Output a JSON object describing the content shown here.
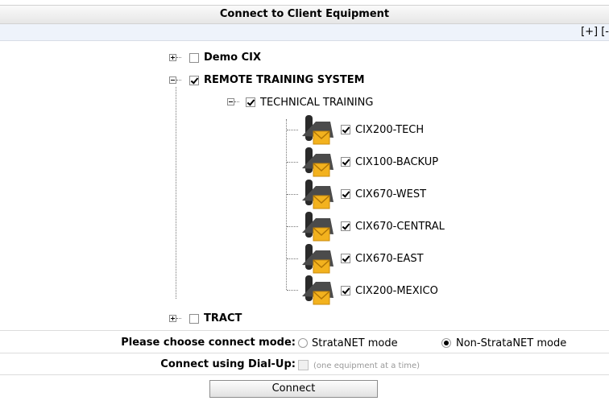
{
  "header": {
    "title": "Connect to Client Equipment"
  },
  "expand_bar": {
    "text": "[+] [-"
  },
  "tree": {
    "nodes": [
      {
        "label": "Demo CIX",
        "checked": false,
        "expanded": false
      },
      {
        "label": "REMOTE TRAINING SYSTEM",
        "checked": true,
        "expanded": true
      },
      {
        "label": "TECHNICAL TRAINING",
        "checked": true,
        "expanded": true
      },
      {
        "label": "CIX200-TECH",
        "checked": true,
        "icon": "phone-email-icon"
      },
      {
        "label": "CIX100-BACKUP",
        "checked": true,
        "icon": "phone-email-icon"
      },
      {
        "label": "CIX670-WEST",
        "checked": true,
        "icon": "phone-email-icon"
      },
      {
        "label": "CIX670-CENTRAL",
        "checked": true,
        "icon": "phone-email-icon"
      },
      {
        "label": "CIX670-EAST",
        "checked": true,
        "icon": "phone-email-icon"
      },
      {
        "label": "CIX200-MEXICO",
        "checked": true,
        "icon": "phone-email-icon"
      },
      {
        "label": "TRACT",
        "checked": false,
        "expanded": false
      }
    ]
  },
  "connect_mode": {
    "label": "Please choose connect mode:",
    "options": [
      {
        "label": "StrataNET mode",
        "selected": false
      },
      {
        "label": "Non-StrataNET mode",
        "selected": true
      }
    ]
  },
  "dialup": {
    "label": "Connect using Dial-Up:",
    "checked": false,
    "disabled": true,
    "hint": "(one equipment at a time)"
  },
  "connect_button": {
    "label": "Connect"
  }
}
